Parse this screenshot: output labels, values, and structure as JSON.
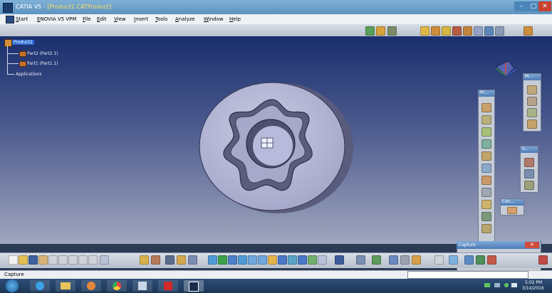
{
  "window": {
    "app_name": "CATIA V5 - ",
    "doc_name": "[Product2.CATProduct]",
    "min": "–",
    "max": "□",
    "close": "✕"
  },
  "menu": {
    "items": [
      "Start",
      "ENOVIA V5 VPM",
      "File",
      "Edit",
      "View",
      "Insert",
      "Tools",
      "Analyze",
      "Window",
      "Help"
    ]
  },
  "tree": {
    "root": "Product2",
    "children": [
      "Part2 (Part2.1)",
      "Part1 (Part1.1)"
    ],
    "applications": "Applications"
  },
  "toolbars": {
    "measure_title": "M...",
    "product_title": "Pr...",
    "s_title": "S...",
    "con_title": "Con..."
  },
  "capture": {
    "title": "Capture",
    "close": "✕"
  },
  "status": {
    "text": "Capture"
  },
  "clock": {
    "time": "5:02 PM",
    "date": "3/14/2016"
  },
  "colors": {
    "part_fill": "#b3b5d3",
    "part_shadow": "#6d6f93",
    "capture_record": "#d11f1f"
  }
}
